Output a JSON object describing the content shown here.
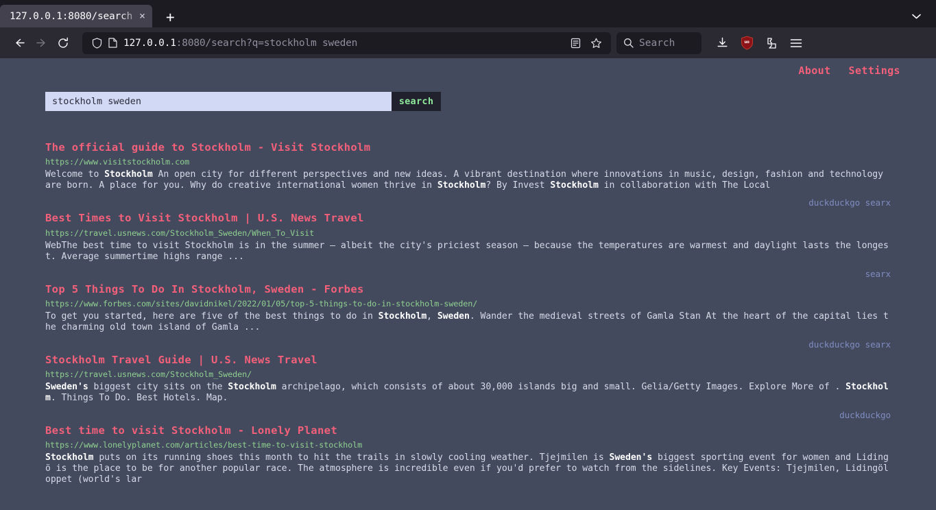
{
  "browser": {
    "tab": {
      "title": "127.0.0.1:8080/search",
      "close_label": "×"
    },
    "new_tab_label": "+",
    "tab_list_chevron": "⌄",
    "nav": {
      "back": "←",
      "forward": "→",
      "reload": "↻"
    },
    "url": {
      "host": "127.0.0.1",
      "rest": ":8080/search?q=stockholm sweden"
    },
    "search_placeholder": "Search",
    "ublock_badge": "uo"
  },
  "page": {
    "header_links": [
      {
        "label": "About"
      },
      {
        "label": "Settings"
      }
    ],
    "search": {
      "value": "stockholm sweden",
      "placeholder": "",
      "submit_label": "search"
    },
    "results": [
      {
        "title": "The official guide to Stockholm - Visit Stockholm",
        "url": "https://www.visitstockholm.com",
        "content_html": "Welcome to <b>Stockholm</b> An open city for different perspectives and new ideas. A vibrant destination where innovations in music, design, fashion and technology are born. A place for you. Why do creative international women thrive in <b>Stockholm</b>? By Invest <b>Stockholm</b> in collaboration with The Local",
        "engines": "duckduckgo searx"
      },
      {
        "title": "Best Times to Visit Stockholm | U.S. News Travel",
        "url": "https://travel.usnews.com/Stockholm_Sweden/When_To_Visit",
        "content_html": "WebThe best time to visit Stockholm is in the summer – albeit the city's priciest season – because the temperatures are warmest and daylight lasts the longest. Average summertime highs range ...",
        "engines": "searx"
      },
      {
        "title": "Top 5 Things To Do In Stockholm, Sweden - Forbes",
        "url": "https://www.forbes.com/sites/davidnikel/2022/01/05/top-5-things-to-do-in-stockholm-sweden/",
        "content_html": "To get you started, here are five of the best things to do in <b>Stockholm</b>, <b>Sweden</b>. Wander the medieval streets of Gamla Stan At the heart of the capital lies the charming old town island of Gamla ...",
        "engines": "duckduckgo searx"
      },
      {
        "title": "Stockholm Travel Guide | U.S. News Travel",
        "url": "https://travel.usnews.com/Stockholm_Sweden/",
        "content_html": "<b>Sweden's</b> biggest city sits on the <b>Stockholm</b> archipelago, which consists of about 30,000 islands big and small. Gelia/Getty Images. Explore More of . <b>Stockholm</b>. Things To Do. Best Hotels. Map.",
        "engines": "duckduckgo"
      },
      {
        "title": "Best time to visit Stockholm - Lonely Planet",
        "url": "https://www.lonelyplanet.com/articles/best-time-to-visit-stockholm",
        "content_html": "<b>Stockholm</b> puts on its running shoes this month to hit the trails in slowly cooling weather. Tjejmilen is <b>Sweden's</b> biggest sporting event for women and Lidingö is the place to be for another popular race. The atmosphere is incredible even if you'd prefer to watch from the sidelines. Key Events: Tjejmilen, Lidingöloppet (world's lar",
        "engines": ""
      }
    ]
  },
  "colors": {
    "page_bg": "#434a5e",
    "title": "#f4607a",
    "url": "#8fd08f",
    "engines": "#7f8cc0",
    "submit_text": "#8ee99a",
    "input_bg": "#d2d9f5"
  }
}
